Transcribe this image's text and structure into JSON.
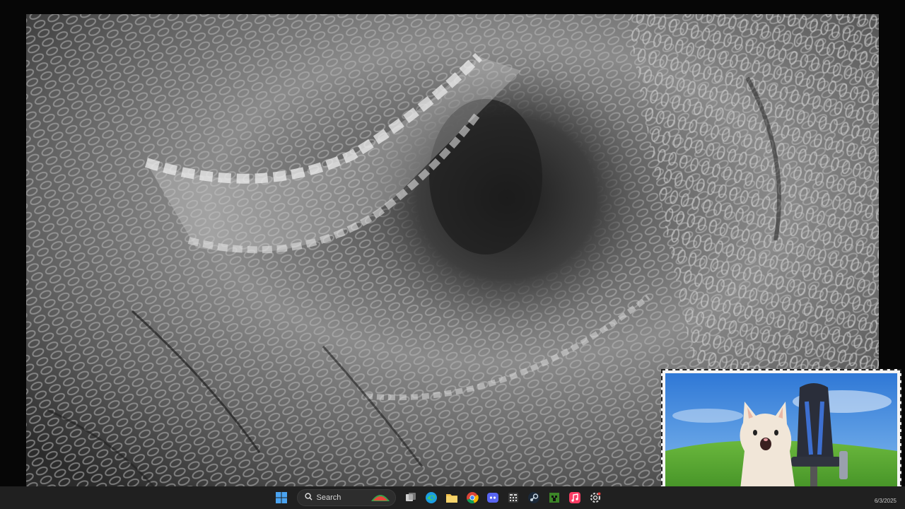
{
  "taskbar": {
    "search_label": "Search",
    "icons": [
      {
        "name": "windows-start-icon",
        "color": "#4aa3f0"
      },
      {
        "name": "search-icon"
      },
      {
        "name": "task-view-icon"
      },
      {
        "name": "edge-icon",
        "color": "#1b9de2"
      },
      {
        "name": "file-explorer-icon",
        "color": "#f2c14e"
      },
      {
        "name": "chrome-icon"
      },
      {
        "name": "discord-icon",
        "color": "#5865f2"
      },
      {
        "name": "calculator-icon"
      },
      {
        "name": "steam-icon",
        "color": "#1b2838"
      },
      {
        "name": "minecraft-icon",
        "color": "#3c8527"
      },
      {
        "name": "itunes-icon",
        "color": "#fb3c64"
      },
      {
        "name": "settings-icon"
      }
    ]
  },
  "tray": {
    "date": "6/3/2025"
  },
  "colors": {
    "taskbar_bg": "#202020",
    "webcam_sky": "#3f88d8",
    "webcam_grass": "#4f9a2e"
  }
}
